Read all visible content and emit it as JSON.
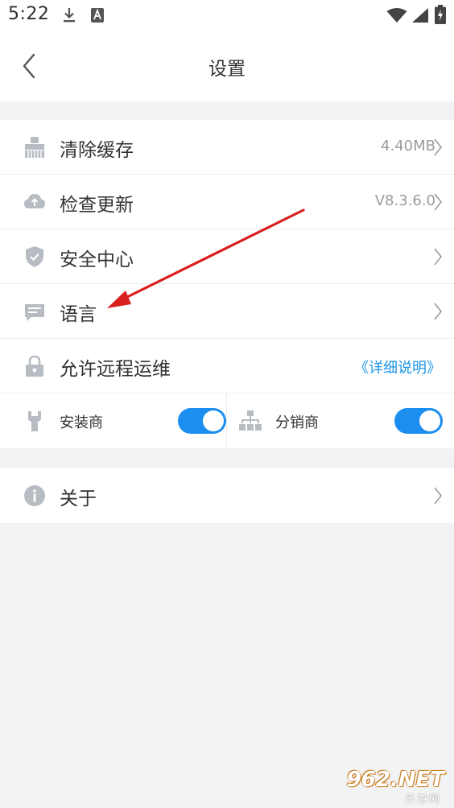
{
  "status_bar": {
    "time": "5:22",
    "icons": [
      "download-icon",
      "accessibility-a-icon",
      "wifi-icon",
      "signal-icon",
      "battery-charging-icon"
    ]
  },
  "header": {
    "title": "设置",
    "back_icon": "back-chevron-icon"
  },
  "settings": {
    "clear_cache": {
      "label": "清除缓存",
      "value": "4.40MB",
      "icon": "broom-icon"
    },
    "check_update": {
      "label": "检查更新",
      "value": "V8.3.6.0",
      "icon": "cloud-upload-icon"
    },
    "security_center": {
      "label": "安全中心",
      "icon": "shield-check-icon"
    },
    "language": {
      "label": "语言",
      "icon": "message-lines-icon"
    },
    "remote_maintenance": {
      "label": "允许远程运维",
      "link": "《详细说明》",
      "icon": "lock-icon"
    },
    "installer": {
      "label": "安装商",
      "enabled": true,
      "icon": "wrench-icon"
    },
    "distributor": {
      "label": "分销商",
      "enabled": true,
      "icon": "hierarchy-icon"
    }
  },
  "about": {
    "label": "关于",
    "icon": "info-circle-icon"
  },
  "watermark": {
    "main": "962.NET",
    "sub": "乐游网"
  },
  "colors": {
    "accent": "#1c8ef0",
    "link": "#1d96e8",
    "icon_gray": "#b7bcc3",
    "background": "#f2f3f5",
    "annotation_arrow": "#d9201f"
  }
}
